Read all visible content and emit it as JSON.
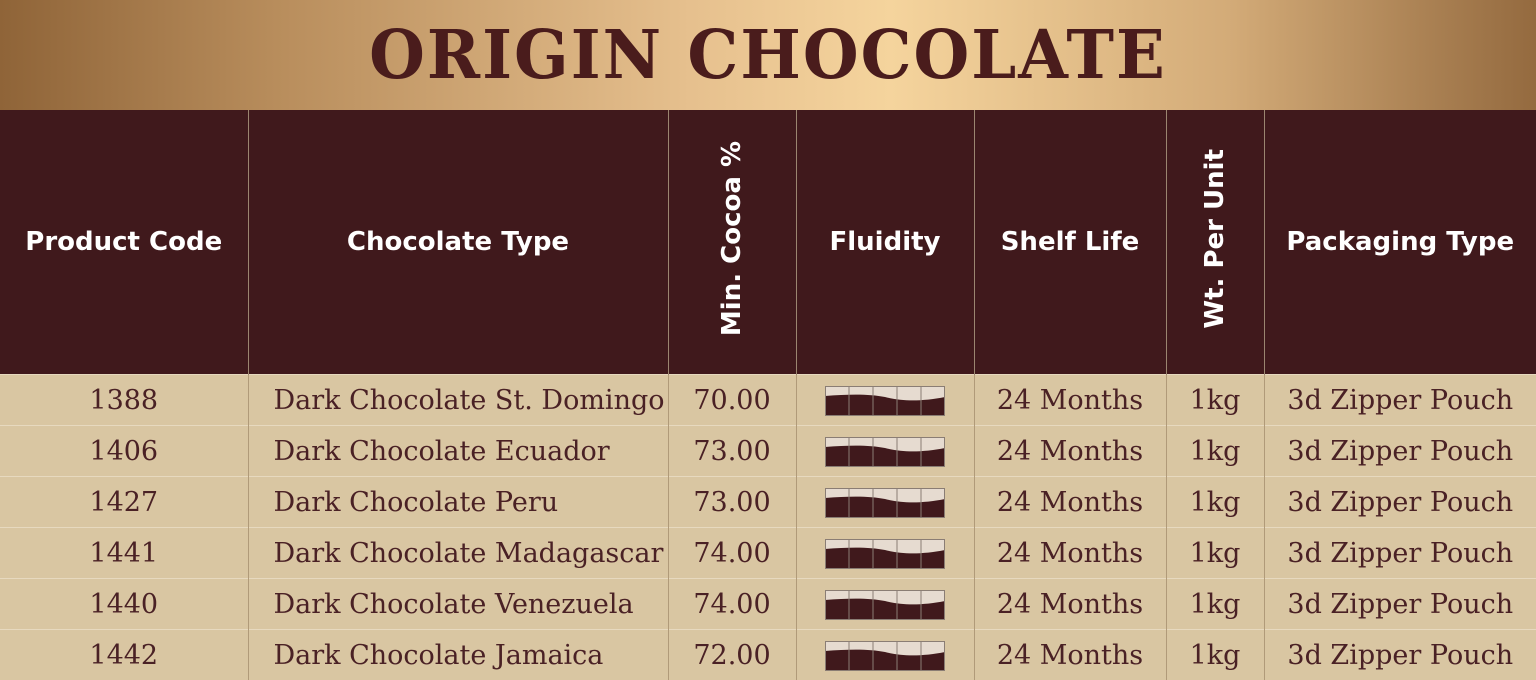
{
  "title": "ORIGIN CHOCOLATE",
  "headers": {
    "code": "Product Code",
    "type": "Chocolate Type",
    "cocoa": "Min. Cocoa %",
    "fluidity": "Fluidity",
    "shelf": "Shelf Life",
    "weight": "Wt. Per Unit",
    "packaging": "Packaging Type"
  },
  "colors": {
    "header_bg": "#40191c",
    "row_bg": "#d9c6a2",
    "text": "#4a2125",
    "fluid_dark": "#40191c",
    "fluid_light": "#e6dbd0"
  },
  "rows": [
    {
      "code": "1388",
      "type": "Dark Chocolate St. Domingo",
      "cocoa": "70.00",
      "fluidity": 3,
      "shelf": "24 Months",
      "weight": "1kg",
      "packaging": "3d Zipper Pouch"
    },
    {
      "code": "1406",
      "type": "Dark Chocolate Ecuador",
      "cocoa": "73.00",
      "fluidity": 3,
      "shelf": "24 Months",
      "weight": "1kg",
      "packaging": "3d Zipper Pouch"
    },
    {
      "code": "1427",
      "type": "Dark Chocolate Peru",
      "cocoa": "73.00",
      "fluidity": 3,
      "shelf": "24 Months",
      "weight": "1kg",
      "packaging": "3d Zipper Pouch"
    },
    {
      "code": "1441",
      "type": "Dark Chocolate Madagascar",
      "cocoa": "74.00",
      "fluidity": 3,
      "shelf": "24 Months",
      "weight": "1kg",
      "packaging": "3d Zipper Pouch"
    },
    {
      "code": "1440",
      "type": "Dark Chocolate Venezuela",
      "cocoa": "74.00",
      "fluidity": 3,
      "shelf": "24 Months",
      "weight": "1kg",
      "packaging": "3d Zipper Pouch"
    },
    {
      "code": "1442",
      "type": "Dark Chocolate Jamaica",
      "cocoa": "72.00",
      "fluidity": 3,
      "shelf": "24 Months",
      "weight": "1kg",
      "packaging": "3d Zipper Pouch"
    }
  ]
}
